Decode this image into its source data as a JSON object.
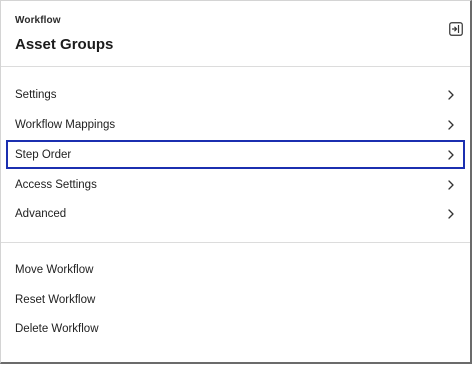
{
  "header": {
    "eyebrow": "Workflow",
    "title": "Asset Groups"
  },
  "nav": {
    "items": [
      {
        "label": "Settings"
      },
      {
        "label": "Workflow Mappings"
      },
      {
        "label": "Step Order"
      },
      {
        "label": "Access Settings"
      },
      {
        "label": "Advanced"
      }
    ],
    "focused_item": "Step Order"
  },
  "actions": {
    "items": [
      {
        "label": "Move Workflow"
      },
      {
        "label": "Reset Workflow"
      },
      {
        "label": "Delete Workflow"
      }
    ]
  },
  "icons": {
    "collapse": "collapse-panel-icon",
    "chevron": "chevron-right-icon"
  },
  "colors": {
    "focus_outline": "#1b2fb0",
    "divider": "#dcdcdc",
    "text": "#222222"
  }
}
